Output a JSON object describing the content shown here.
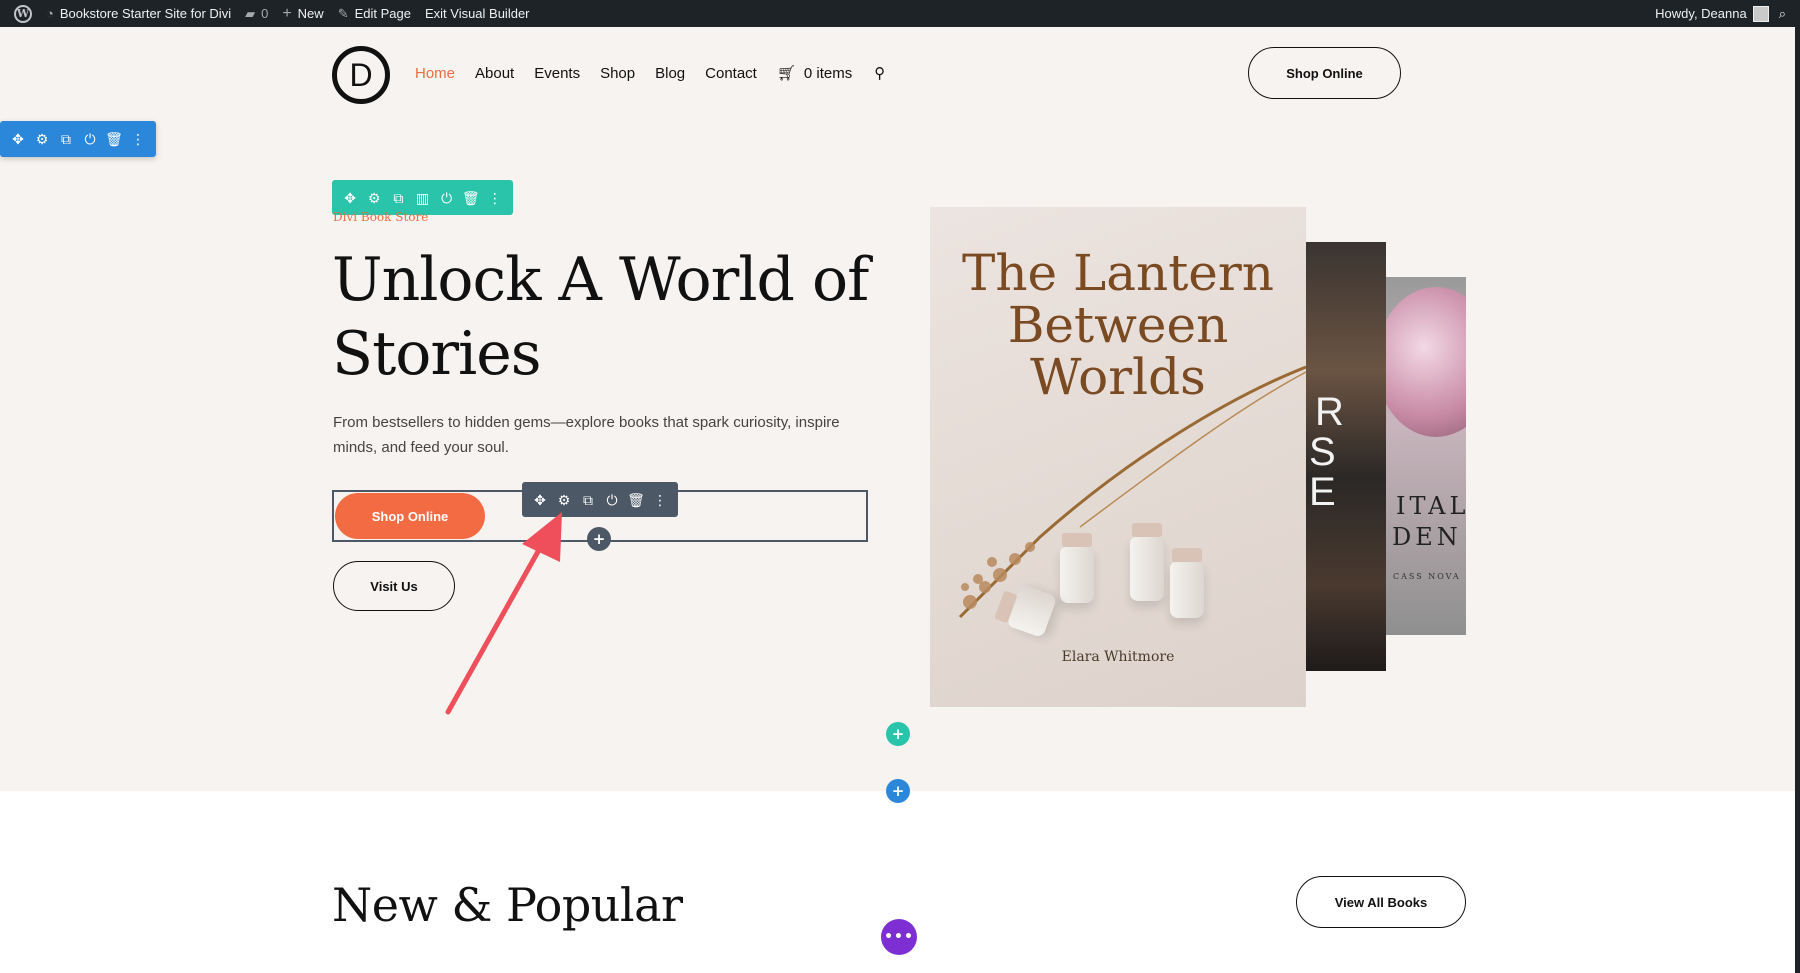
{
  "adminbar": {
    "site_name": "Bookstore Starter Site for Divi",
    "comments": "0",
    "new": "New",
    "edit_page": "Edit Page",
    "exit_builder": "Exit Visual Builder",
    "greeting": "Howdy, Deanna"
  },
  "header": {
    "logo_letter": "D",
    "nav": [
      "Home",
      "About",
      "Events",
      "Shop",
      "Blog",
      "Contact"
    ],
    "cart": "0 items",
    "shop_button": "Shop Online"
  },
  "hero": {
    "eyebrow": "Divi Book Store",
    "title": "Unlock A World of Stories",
    "text": "From bestsellers to hidden gems—explore books that spark curiosity, inspire minds, and feed your soul.",
    "primary_button": "Shop Online",
    "secondary_button": "Visit Us"
  },
  "books": {
    "front": {
      "title": "The Lantern Between Worlds",
      "author": "Elara Whitmore"
    },
    "middle": {
      "letters": [
        "R",
        "S",
        "E"
      ]
    },
    "back": {
      "line1": "ITAL",
      "line2": "DEN",
      "author": "CASS NOVA"
    }
  },
  "section2": {
    "title": "New & Popular",
    "button": "View All Books"
  },
  "builder": {
    "add_symbol": "+",
    "more_symbol": "•••"
  },
  "colors": {
    "accent": "#f26b43",
    "section_toolbar": "#2b87da",
    "row_toolbar": "#29c4a9",
    "module_toolbar": "#4c5866",
    "purple": "#7d2fd3"
  }
}
